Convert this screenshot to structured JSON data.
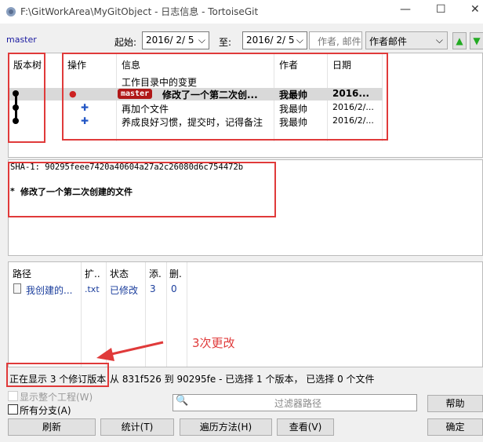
{
  "window": {
    "title": "F:\\GitWorkArea\\MyGitObject - 日志信息 - TortoiseGit",
    "minimize": "—",
    "maximize": "☐",
    "close": "✕"
  },
  "toolbar": {
    "branch": "master",
    "from_label": "起始:",
    "from_date": "2016/ 2/ 5",
    "to_label": "至:",
    "to_date": "2016/ 2/ 5",
    "search_placeholder": "作者, 邮件",
    "filter_field": "作者邮件"
  },
  "log": {
    "headers": {
      "graph": "版本树",
      "actions": "操作",
      "message": "信息",
      "author": "作者",
      "date": "日期"
    },
    "working_dir": "工作目录中的变更",
    "rows": [
      {
        "ref": "master",
        "message": "修改了一个第二次创...",
        "author": "我最帅",
        "date": "2016..."
      },
      {
        "message": "再加个文件",
        "author": "我最帅",
        "date": "2016/2/..."
      },
      {
        "message": "养成良好习惯，提交时，记得备注",
        "author": "我最帅",
        "date": "2016/2/..."
      }
    ]
  },
  "detail": {
    "sha": "SHA-1: 90295feee7420a40604a27a2c26080d6c754472b",
    "bullet": "*",
    "message": "修改了一个第二次创建的文件"
  },
  "files": {
    "headers": {
      "path": "路径",
      "ext": "扩..",
      "status": "状态",
      "added": "添.",
      "deleted": "删."
    },
    "rows": [
      {
        "path": "我创建的...",
        "ext": ".txt",
        "status": "已修改",
        "added": "3",
        "deleted": "0"
      }
    ]
  },
  "annotation": "3次更改",
  "status": {
    "text_boxed": "正在显示 3 个修订版本，",
    "text_rest": "从 831f526 到 90295fe - 已选择 1 个版本， 已选择 0 个文件"
  },
  "options": {
    "whole_project": "显示整个工程(W)",
    "all_branches": "所有分支(A)",
    "filter_placeholder": "过滤器路径"
  },
  "buttons": {
    "help": "帮助",
    "refresh": "刷新",
    "stats": "统计(T)",
    "walk": "遍历方法(H)",
    "view": "查看(V)",
    "ok": "确定"
  }
}
